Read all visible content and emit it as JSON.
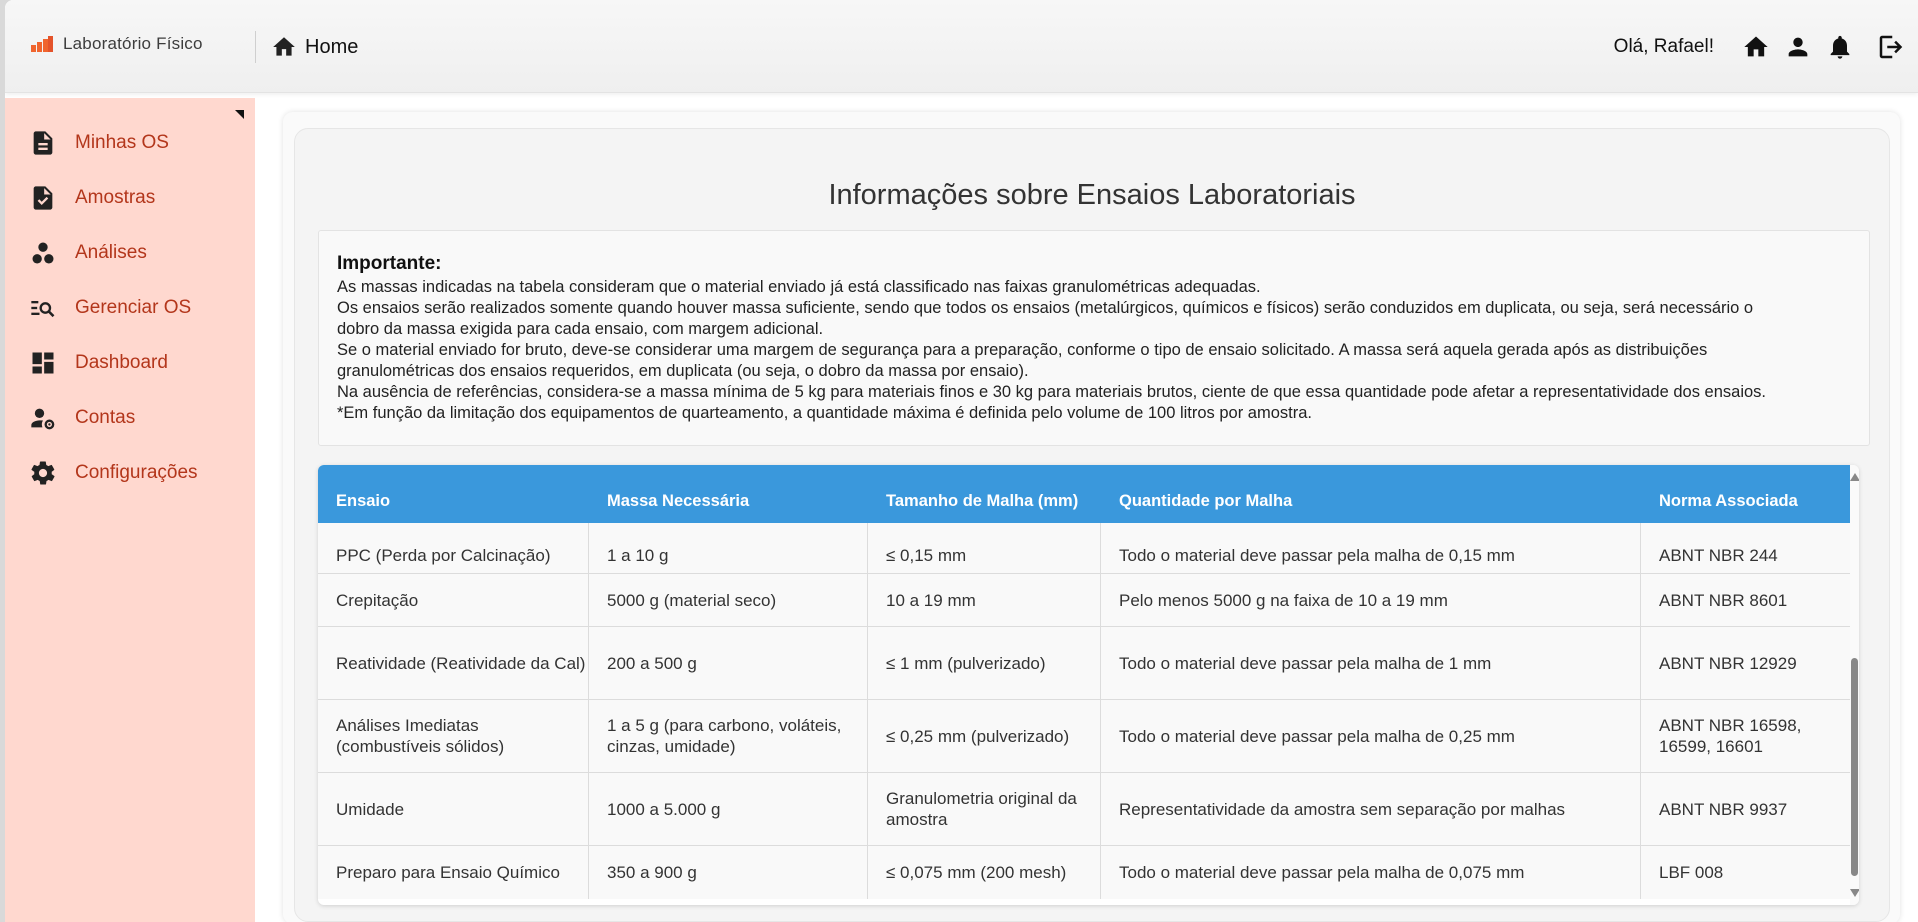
{
  "header": {
    "brand_name": "Laboratório Físico",
    "breadcrumb": "Home",
    "greeting": "Olá, Rafael!",
    "icons": [
      "home-icon",
      "user-icon",
      "bell-icon",
      "logout-icon"
    ]
  },
  "sidebar": {
    "items": [
      {
        "label": "Minhas OS",
        "icon": "document-icon"
      },
      {
        "label": "Amostras",
        "icon": "file-check-icon"
      },
      {
        "label": "Análises",
        "icon": "bubbles-icon"
      },
      {
        "label": "Gerenciar OS",
        "icon": "manage-search-icon"
      },
      {
        "label": "Dashboard",
        "icon": "dashboard-icon"
      },
      {
        "label": "Contas",
        "icon": "account-settings-icon"
      },
      {
        "label": "Configurações",
        "icon": "gear-icon"
      }
    ]
  },
  "main": {
    "title": "Informações sobre Ensaios Laboratoriais",
    "notice": {
      "title": "Importante:",
      "lines": [
        "As massas indicadas na tabela consideram que o material enviado já está classificado nas faixas granulométricas adequadas.",
        "Os ensaios serão realizados somente quando houver massa suficiente, sendo que todos os ensaios (metalúrgicos, químicos e físicos) serão conduzidos em duplicata, ou seja, será necessário o",
        "dobro da massa exigida para cada ensaio, com margem adicional.",
        "Se o material enviado for bruto, deve-se considerar uma margem de segurança para a preparação, conforme o tipo de ensaio solicitado. A massa será aquela gerada após as distribuições",
        "granulométricas dos ensaios requeridos, em duplicata (ou seja, o dobro da massa por ensaio).",
        "Na ausência de referências, considera-se a massa mínima de 5 kg para materiais finos e 30 kg para materiais brutos, ciente de que essa quantidade pode afetar a representatividade dos ensaios.",
        "*Em função da limitação dos equipamentos de quarteamento, a quantidade máxima é definida pelo volume de 100 litros por amostra."
      ]
    },
    "table": {
      "columns": [
        "Ensaio",
        "Massa Necessária",
        "Tamanho de Malha (mm)",
        "Quantidade por Malha",
        "Norma Associada"
      ],
      "rows": [
        [
          "PPC (Perda por Calcinação)",
          "1 a 10 g",
          "≤ 0,15 mm",
          "Todo o material deve passar pela malha de 0,15 mm",
          "ABNT NBR 244"
        ],
        [
          "Crepitação",
          "5000 g (material seco)",
          "10 a 19 mm",
          "Pelo menos 5000 g na faixa de 10 a 19 mm",
          "ABNT NBR 8601"
        ],
        [
          "Reatividade (Reatividade da Cal)",
          "200 a 500 g",
          "≤ 1 mm (pulverizado)",
          "Todo o material deve passar pela malha de 1 mm",
          "ABNT NBR 12929"
        ],
        [
          "Análises Imediatas (combustíveis sólidos)",
          "1 a 5 g (para carbono, voláteis, cinzas, umidade)",
          "≤ 0,25 mm (pulverizado)",
          "Todo o material deve passar pela malha de 0,25 mm",
          "ABNT NBR 16598, 16599, 16601"
        ],
        [
          "Umidade",
          "1000 a 5.000 g",
          "Granulometria original da amostra",
          "Representatividade da amostra sem separação por malhas",
          "ABNT NBR 9937"
        ],
        [
          "Preparo para Ensaio Químico",
          "350 a 900 g",
          "≤ 0,075 mm (200 mesh)",
          "Todo o material deve passar pela malha de 0,075 mm",
          "LBF 008"
        ]
      ]
    }
  },
  "colors": {
    "sidebar_bg": "#ffd8cf",
    "nav_text": "#b3361b",
    "table_header": "#3a98dc",
    "brand_orange": "#f0642d"
  }
}
